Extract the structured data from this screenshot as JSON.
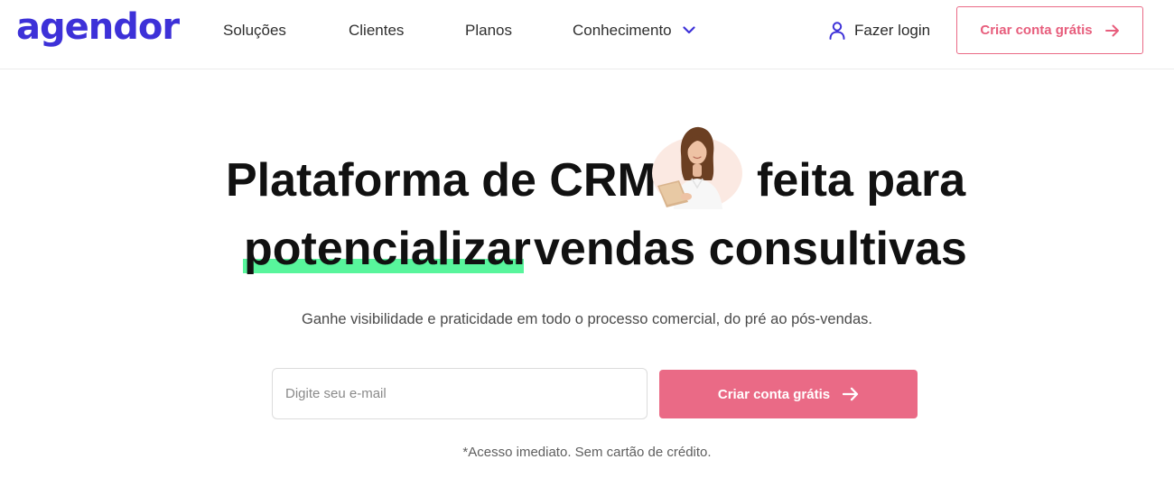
{
  "brand": {
    "logo_text": "agendor",
    "color": "#3d31d8"
  },
  "nav": {
    "items": [
      {
        "label": "Soluções"
      },
      {
        "label": "Clientes"
      },
      {
        "label": "Planos"
      },
      {
        "label": "Conhecimento",
        "icon": "chevron-down-icon"
      }
    ],
    "login_label": "Fazer login",
    "login_icon": "user-icon",
    "cta_label": "Criar conta grátis",
    "cta_icon": "arrow-right-icon"
  },
  "hero": {
    "headline": {
      "part1": "Plataforma de CRM",
      "part2": "feita para",
      "highlighted_word": "potencializar",
      "part3": "vendas consultivas"
    },
    "avatar_icon": "woman-with-clipboard-photo",
    "subtitle": "Ganhe visibilidade e praticidade em todo o processo comercial, do pré ao pós-vendas.",
    "email_placeholder": "Digite seu e-mail",
    "cta_label": "Criar conta grátis",
    "disclaimer": "*Acesso imediato. Sem cartão de crédito."
  },
  "colors": {
    "accent_pink": "#ea6a86",
    "highlight_green": "#58f59c",
    "brand_purple": "#3d31d8"
  }
}
